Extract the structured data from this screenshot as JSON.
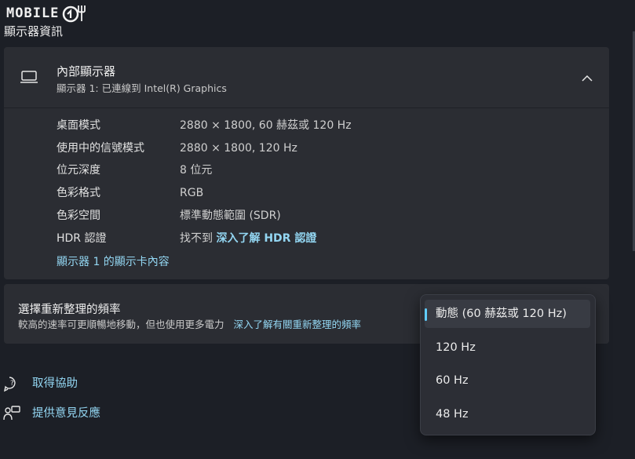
{
  "logo": {
    "text": "MOBILE"
  },
  "page_title": "顯示器資訊",
  "display": {
    "name": "內部顯示器",
    "subtitle": "顯示器 1: 已連線到 Intel(R) Graphics",
    "rows": [
      {
        "label": "桌面模式",
        "value": "2880 × 1800, 60 赫茲或 120 Hz"
      },
      {
        "label": "使用中的信號模式",
        "value": "2880 × 1800, 120 Hz"
      },
      {
        "label": "位元深度",
        "value": "8 位元"
      },
      {
        "label": "色彩格式",
        "value": "RGB"
      },
      {
        "label": "色彩空間",
        "value": "標準動態範圍 (SDR)"
      },
      {
        "label": "HDR 認證",
        "value": "找不到",
        "link": "深入了解 HDR 認證"
      }
    ],
    "adapter_link": "顯示器 1 的顯示卡內容"
  },
  "refresh": {
    "title": "選擇重新整理的頻率",
    "description": "較高的速率可更順暢地移動，但也使用更多電力",
    "link": "深入了解有關重新整理的頻率"
  },
  "dropdown": {
    "selected_index": 0,
    "options": [
      "動態 (60 赫茲或 120 Hz)",
      "120 Hz",
      "60 Hz",
      "48 Hz"
    ]
  },
  "footer": {
    "help": "取得協助",
    "feedback": "提供意見反應"
  },
  "colors": {
    "accent": "#60cdff",
    "link": "#93d6f2",
    "background": "#1c1f26",
    "card": "#2b2d33"
  },
  "icons": [
    "laptop-monitor-icon",
    "chevron-up-icon",
    "help-icon",
    "feedback-icon"
  ]
}
